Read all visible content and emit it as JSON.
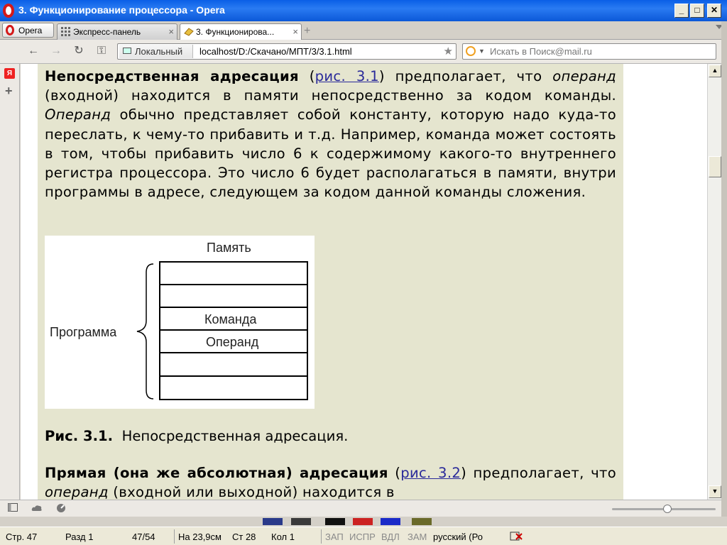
{
  "window": {
    "title": "3. Функционирование процессора - Opera",
    "controls": {
      "minimize": "_",
      "maximize": "□",
      "close": "✕"
    }
  },
  "tabbar": {
    "menu_label": "Opera",
    "tabs": [
      {
        "label": "Экспресс-панель",
        "icon": "speed-dial-icon",
        "close": "×"
      },
      {
        "label": "3. Функционирова...",
        "icon": "page-icon",
        "close": "×"
      }
    ],
    "new_tab": "+"
  },
  "navbar": {
    "back": "←",
    "forward": "→",
    "reload": "↻",
    "key": "⚿",
    "security_label": "Локальный",
    "url": "localhost/D:/Скачано/МПТ/3/3.1.html",
    "bookmark_star": "★",
    "search_placeholder": "Искать в Поиск@mail.ru"
  },
  "sidepanel": {
    "yandex_label": "Я",
    "add": "+"
  },
  "content": {
    "p1": {
      "bold1": "Непосредственная адресация",
      "t1": " (",
      "link1": "рис. 3.1",
      "t2": ") предполагает, что ",
      "i1": "операнд",
      "t3": " (входной) находится в памяти непосредственно за кодом команды. ",
      "i2": "Операнд",
      "t4": " обычно представляет собой константу, которую надо куда-то переслать, к чему-то прибавить и т.д. Например, команда может состоять в том, чтобы прибавить число 6 к содержимому какого-то внутреннего регистра процессора. Это число 6 будет располагаться в памяти, внутри программы в адресе, следующем за кодом данной команды сложения."
    },
    "figure": {
      "memory_label": "Память",
      "program_label": "Программа",
      "cells": [
        "",
        "",
        "Команда",
        "Операнд",
        "",
        ""
      ]
    },
    "caption": {
      "num": "Рис. 3.1.",
      "text": "Непосредственная адресация."
    },
    "p2": {
      "bold1": "Прямая (она же абсолютная) адресация",
      "t1": " (",
      "link1": "рис. 3.2",
      "t2": ") предполагает, что ",
      "i1": "операнд",
      "t3": " (входной или выходной) находится в"
    }
  },
  "scrollbar": {
    "up": "▲",
    "down": "▼"
  },
  "word_status": {
    "page": "Стр. 47",
    "section": "Разд 1",
    "pages": "47/54",
    "position": "На 23,9см",
    "line": "Ст 28",
    "column": "Кол 1",
    "rec": "ЗАП",
    "trk": "ИСПР",
    "ext": "ВДЛ",
    "ovr": "ЗАМ",
    "language": "русский (Ро"
  },
  "colors": {
    "title_bar": "#0a5fe6",
    "article_bg": "#e5e5cf",
    "link": "#2a2a9a"
  }
}
